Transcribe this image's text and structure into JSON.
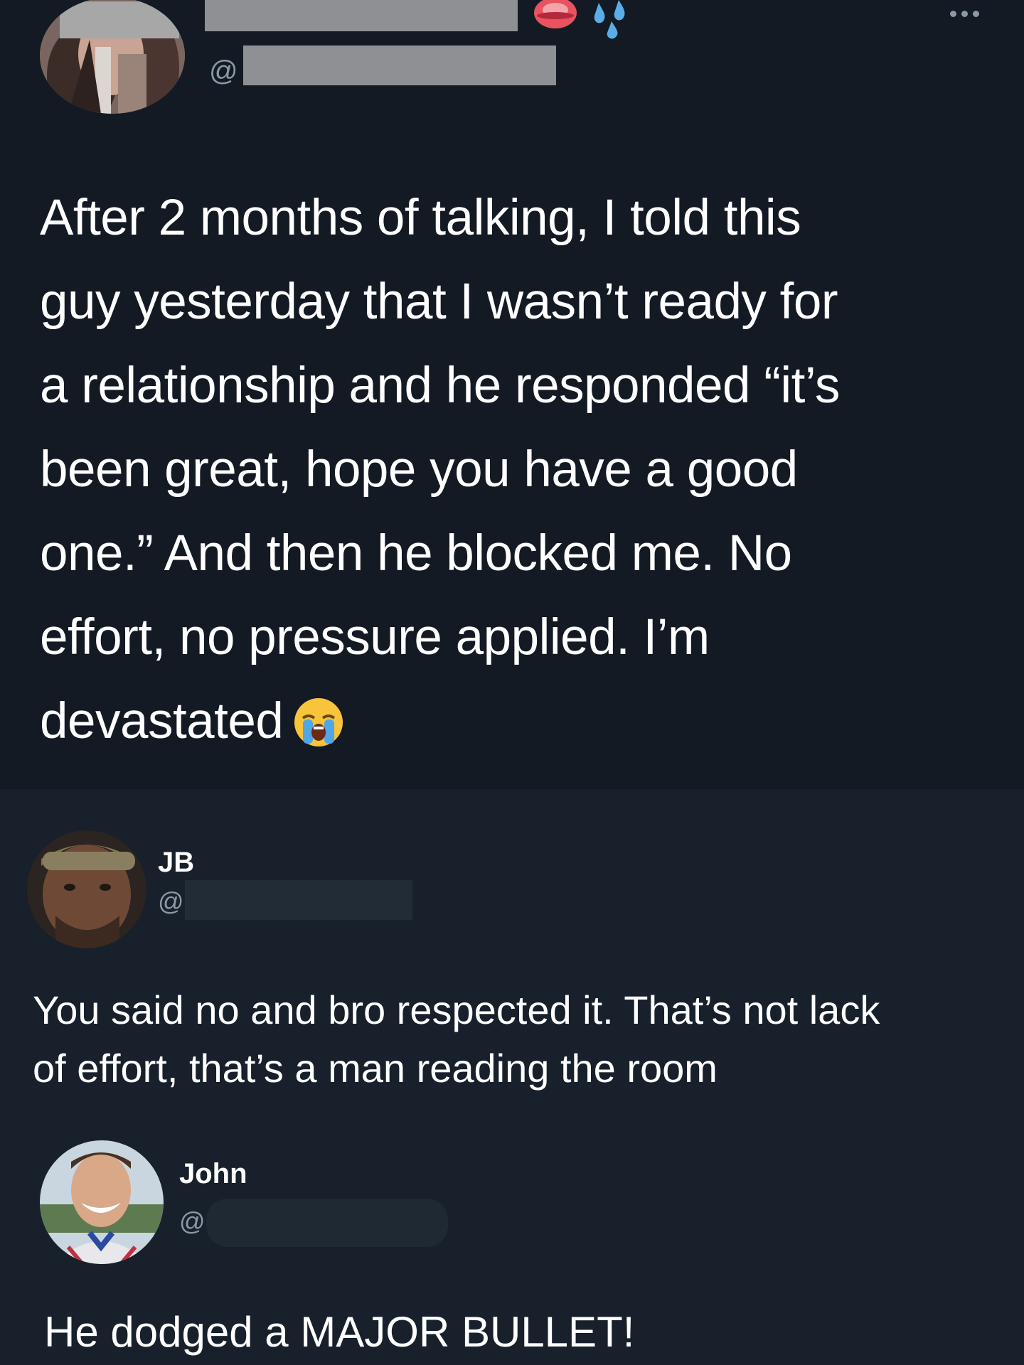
{
  "main_tweet": {
    "handle_prefix": "@",
    "text_lines": [
      "After 2 months of talking, I told this",
      "guy yesterday that I wasn’t ready for",
      "a relationship and he responded “it’s",
      "been great, hope you have a good",
      "one.” And then he blocked me. No",
      "effort, no pressure applied. I’m",
      "devastated"
    ],
    "emoji": "loudly-crying-face",
    "name_emojis": [
      "lips",
      "sweat-droplets"
    ]
  },
  "replies": [
    {
      "name": "JB",
      "handle_prefix": "@",
      "text_lines": [
        "You said no and bro respected it. That’s not lack",
        "of effort, that’s a man reading the room"
      ]
    },
    {
      "name": "John",
      "handle_prefix": "@",
      "text_lines": [
        "He dodged a MAJOR BULLET!"
      ]
    }
  ],
  "colors": {
    "background_main": "#131a24",
    "background_replies": "#17202b",
    "text": "#ffffff",
    "muted": "#8b98a5",
    "redaction": "#8e9094"
  }
}
